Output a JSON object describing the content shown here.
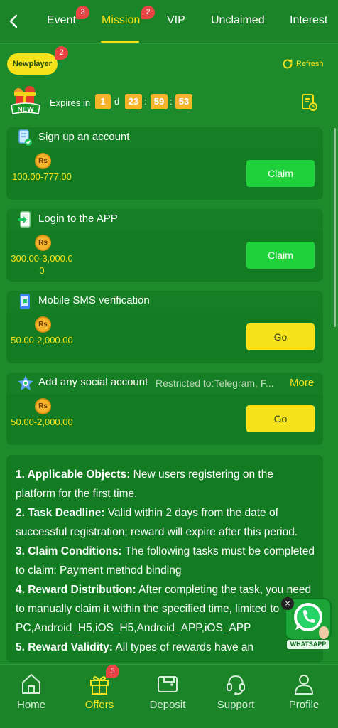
{
  "header": {
    "tabs": [
      {
        "label": "Event",
        "badge": "3"
      },
      {
        "label": "Mission",
        "badge": "2",
        "active": true
      },
      {
        "label": "VIP"
      },
      {
        "label": "Unclaimed"
      },
      {
        "label": "Interest"
      }
    ]
  },
  "subheader": {
    "category_label": "Newplayer",
    "category_badge": "2",
    "refresh_label": "Refresh",
    "new_tag": "NEW",
    "expires_label": "Expires in",
    "timer": {
      "days": "1",
      "day_unit": "d",
      "hours": "23",
      "minutes": "59",
      "seconds": "53",
      "separator": ":"
    }
  },
  "tasks": [
    {
      "title": "Sign up an account",
      "currency": "Rs",
      "reward": "100.00-777.00",
      "action": "Claim"
    },
    {
      "title": "Login to the APP",
      "currency": "Rs",
      "reward": "300.00-3,000.00",
      "action": "Claim"
    },
    {
      "title": "Mobile SMS verification",
      "currency": "Rs",
      "reward": "50.00-2,000.00",
      "action": "Go"
    },
    {
      "title": "Add any social account",
      "restriction": "Restricted to:Telegram, F...",
      "more": "More",
      "currency": "Rs",
      "reward": "50.00-2,000.00",
      "action": "Go"
    }
  ],
  "rules": [
    {
      "heading": "1. Applicable Objects:",
      "text": " New users registering on the platform for the first time."
    },
    {
      "heading": "2. Task Deadline:",
      "text": " Valid within 2 days from the date of successful registration; reward will expire after this period."
    },
    {
      "heading": "3. Claim Conditions:",
      "text": " The following tasks must be completed to claim: Payment method binding"
    },
    {
      "heading": "4. Reward Distribution:",
      "text": " After completing the task, you need to manually claim it within the specified time, limited to PC,Android_H5,iOS_H5,Android_APP,iOS_APP"
    },
    {
      "heading": "5. Reward Validity:",
      "text": " All types of rewards have an"
    }
  ],
  "whatsapp": {
    "label": "WHATSAPP",
    "close": "×"
  },
  "bottom_nav": [
    {
      "label": "Home",
      "icon": "home-icon"
    },
    {
      "label": "Offers",
      "icon": "gift-icon",
      "badge": "5",
      "active": true
    },
    {
      "label": "Deposit",
      "icon": "wallet-icon"
    },
    {
      "label": "Support",
      "icon": "headset-icon"
    },
    {
      "label": "Profile",
      "icon": "user-icon"
    }
  ],
  "colors": {
    "background": "#1d8a2c",
    "card": "#137c23",
    "accent_yellow": "#f5e21a",
    "claim_green": "#1fd13a",
    "badge_red": "#e94545",
    "timer_orange": "#f5b32a"
  }
}
